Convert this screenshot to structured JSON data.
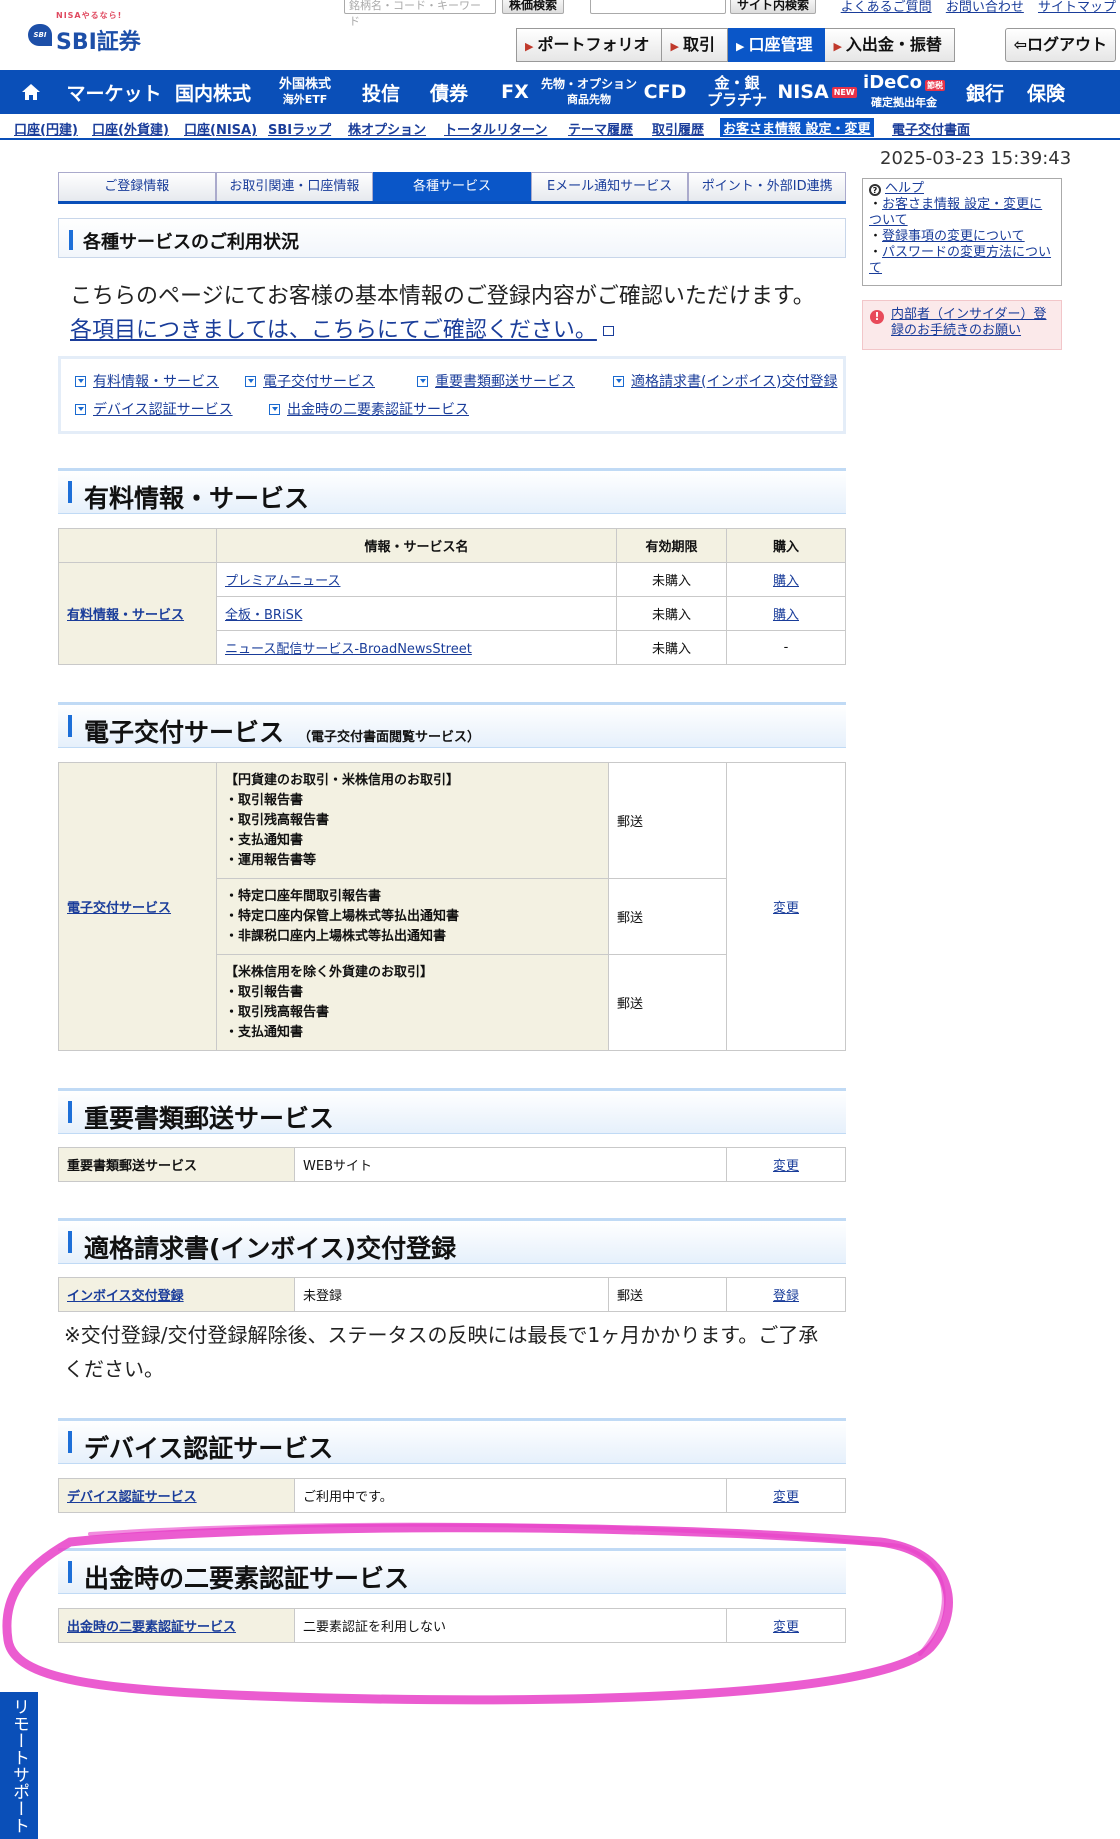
{
  "header": {
    "logo_tagline": "NISAやるなら!",
    "logo_mark": "SBI",
    "logo_brand": "SBI証券",
    "search_placeholder": "銘柄名・コード・キーワード",
    "stock_search_label": "株価検索",
    "site_search_label": "サイト内検索",
    "help_links": [
      "よくあるご質問",
      "お問い合わせ",
      "サイトマップ"
    ],
    "tabs": [
      "ポートフォリオ",
      "取引",
      "口座管理",
      "入出金・振替"
    ],
    "active_tab": "口座管理",
    "logout_label": "ログアウト"
  },
  "main_nav": {
    "items": [
      {
        "label": "マーケット"
      },
      {
        "label": "国内株式"
      },
      {
        "line1": "外国株式",
        "line2": "海外ETF"
      },
      {
        "label": "投信"
      },
      {
        "label": "債券"
      },
      {
        "label": "FX"
      },
      {
        "line1": "先物・オプション",
        "line2": "商品先物"
      },
      {
        "label": "CFD"
      },
      {
        "line1": "金・銀",
        "line2": "プラチナ"
      },
      {
        "label": "NISA",
        "badge": "NEW"
      },
      {
        "line1": "iDeCo",
        "badge": "節税",
        "line2": "確定拠出年金"
      },
      {
        "label": "銀行"
      },
      {
        "label": "保険"
      }
    ]
  },
  "sub_nav": {
    "items": [
      "口座(円建)",
      "口座(外貨建)",
      "口座(NISA)",
      "SBIラップ",
      "株オプション",
      "トータルリターン",
      "テーマ履歴",
      "取引履歴",
      "お客さま情報 設定・変更",
      "電子交付書面"
    ],
    "selected": "お客さま情報 設定・変更"
  },
  "timestamp": "2025-03-23 15:39:43",
  "content_tabs": {
    "items": [
      "ご登録情報",
      "お取引関連・口座情報",
      "各種サービス",
      "Eメール通知サービス",
      "ポイント・外部ID連携"
    ],
    "active": "各種サービス"
  },
  "status": {
    "title": "各種サービスのご利用状況",
    "intro_line1": "こちらのページにてお客様の基本情報のご登録内容がご確認いただけます。",
    "intro_line2": "各項目につきましては、こちらにてご確認ください。"
  },
  "anchors": [
    "有料情報・サービス",
    "電子交付サービス",
    "重要書類郵送サービス",
    "適格請求書(インボイス)交付登録",
    "デバイス認証サービス",
    "出金時の二要素認証サービス"
  ],
  "paid_services": {
    "title": "有料情報・サービス",
    "headers": [
      "情報・サービス名",
      "有効期限",
      "購入"
    ],
    "row_label": "有料情報・サービス",
    "rows": [
      {
        "name": "プレミアムニュース",
        "expiry": "未購入",
        "action": "購入"
      },
      {
        "name": "全板・BRiSK",
        "expiry": "未購入",
        "action": "購入"
      },
      {
        "name": "ニュース配信サービス-BroadNewsStreet",
        "expiry": "未購入",
        "action": "-"
      }
    ]
  },
  "e_delivery": {
    "title": "電子交付サービス",
    "note": "（電子交付書面閲覧サービス）",
    "row_label": "電子交付サービス",
    "groups": [
      {
        "lines": [
          "【円貨建のお取引・米株信用のお取引】",
          "・取引報告書",
          "・取引残高報告書",
          "・支払通知書",
          "・運用報告書等"
        ],
        "method": "郵送"
      },
      {
        "lines": [
          "・特定口座年間取引報告書",
          "・特定口座内保管上場株式等払出通知書",
          "・非課税口座内上場株式等払出通知書"
        ],
        "method": "郵送"
      },
      {
        "lines": [
          "【米株信用を除く外貨建のお取引】",
          "・取引報告書",
          "・取引残高報告書",
          "・支払通知書"
        ],
        "method": "郵送"
      }
    ],
    "action": "変更"
  },
  "important_mail": {
    "title": "重要書類郵送サービス",
    "label": "重要書類郵送サービス",
    "value": "WEBサイト",
    "action": "変更"
  },
  "invoice": {
    "title": "適格請求書(インボイス)交付登録",
    "label": "インボイス交付登録",
    "value": "未登録",
    "method": "郵送",
    "action": "登録",
    "notice": "※交付登録/交付登録解除後、ステータスの反映には最長で1ヶ月かかります。ご了承ください。"
  },
  "device_auth": {
    "title": "デバイス認証サービス",
    "label": "デバイス認証サービス",
    "value": "ご利用中です。",
    "action": "変更"
  },
  "two_factor": {
    "title": "出金時の二要素認証サービス",
    "label": "出金時の二要素認証サービス",
    "value": "二要素認証を利用しない",
    "action": "変更"
  },
  "sidebar": {
    "help_title": "ヘルプ",
    "help_items": [
      "お客さま情報 設定・変更について",
      "登録事項の変更について",
      "パスワードの変更方法について"
    ],
    "insider": "内部者（インサイダー）登録のお手続きのお願い"
  },
  "remote_support": "リモートサポート",
  "colors": {
    "nav_blue": "#0a4fb8",
    "highlight": "#e840c8",
    "table_label_bg": "#f3f1e2"
  }
}
